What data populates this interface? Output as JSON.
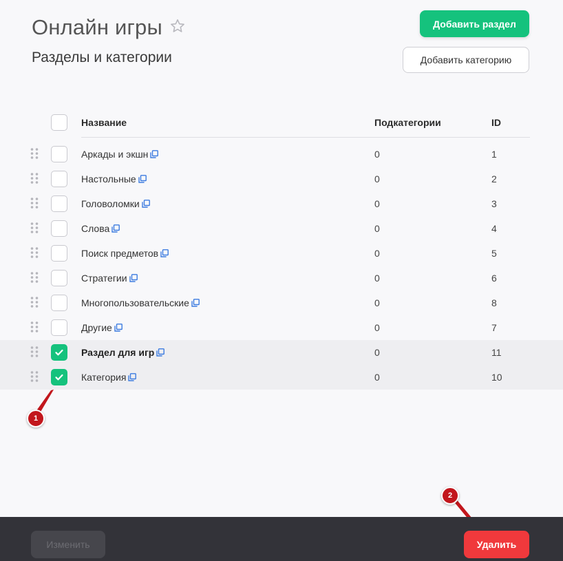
{
  "header": {
    "title": "Онлайн игры",
    "subtitle": "Разделы и категории",
    "add_section_label": "Добавить раздел",
    "add_category_label": "Добавить категорию"
  },
  "table": {
    "columns": [
      "Название",
      "Подкатегории",
      "ID"
    ],
    "rows": [
      {
        "name": "Аркады и экшн",
        "subcategories": "0",
        "id": "1",
        "checked": false,
        "bold": false
      },
      {
        "name": "Настольные",
        "subcategories": "0",
        "id": "2",
        "checked": false,
        "bold": false
      },
      {
        "name": "Головоломки",
        "subcategories": "0",
        "id": "3",
        "checked": false,
        "bold": false
      },
      {
        "name": "Слова",
        "subcategories": "0",
        "id": "4",
        "checked": false,
        "bold": false
      },
      {
        "name": "Поиск предметов",
        "subcategories": "0",
        "id": "5",
        "checked": false,
        "bold": false
      },
      {
        "name": "Стратегии",
        "subcategories": "0",
        "id": "6",
        "checked": false,
        "bold": false
      },
      {
        "name": "Многопользовательские",
        "subcategories": "0",
        "id": "8",
        "checked": false,
        "bold": false
      },
      {
        "name": "Другие",
        "subcategories": "0",
        "id": "7",
        "checked": false,
        "bold": false
      },
      {
        "name": "Раздел для игр",
        "subcategories": "0",
        "id": "11",
        "checked": true,
        "bold": true
      },
      {
        "name": "Категория",
        "subcategories": "0",
        "id": "10",
        "checked": true,
        "bold": false
      }
    ]
  },
  "footer": {
    "edit_label": "Изменить",
    "delete_label": "Удалить"
  },
  "callouts": [
    "1",
    "2"
  ],
  "colors": {
    "accent": "#15c27d",
    "danger": "#f0393c",
    "callout": "#c2161c",
    "link_icon": "#3b7be0"
  }
}
